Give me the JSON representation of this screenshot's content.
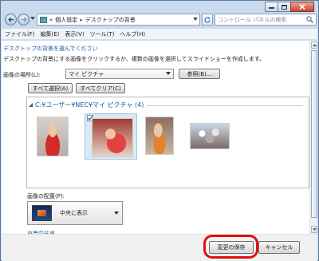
{
  "address": {
    "prefix": "«",
    "crumb1": "個人設定",
    "separator": "▸",
    "crumb2": "デスクトップの背景"
  },
  "search": {
    "placeholder": "コントロール パネルの検索"
  },
  "menu": [
    "ファイル(F)",
    "編集(E)",
    "表示(V)",
    "ツール(T)",
    "ヘルプ(H)"
  ],
  "main": {
    "heading": "デスクトップの背景を選んでください",
    "description": "デスクトップの背景にする画像をクリックするか、複数の画像を選択してスライドショーを作成します。",
    "location_label": "画像の場所(L):",
    "location_value": "マイ ピクチャ",
    "browse_button": "参照(B)...",
    "select_all_button": "すべて選択(A)",
    "clear_all_button": "すべてクリア(C)",
    "group_header": "C:¥ユーザー¥NEC¥マイ ピクチャ (4)",
    "position_label": "画像の配置(P):",
    "position_value": "中央に表示",
    "change_link": "背景の変更"
  },
  "footer": {
    "save_button": "変更の保存",
    "cancel_button": "キャンセル"
  },
  "colors": {
    "link_blue": "#1c5aa5",
    "highlight_red": "#e01010"
  }
}
